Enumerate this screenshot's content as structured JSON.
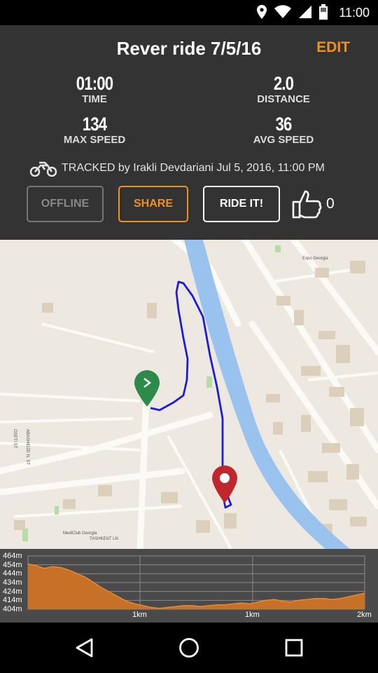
{
  "status_bar": {
    "time": "11:00"
  },
  "header": {
    "title": "Rever ride 7/5/16",
    "edit_label": "EDIT",
    "stats": {
      "time": {
        "value": "01:00",
        "label": "TIME"
      },
      "distance": {
        "value": "2.0",
        "label": "DISTANCE"
      },
      "max_speed": {
        "value": "134",
        "label": "MAX SPEED"
      },
      "avg_speed": {
        "value": "36",
        "label": "AVG SPEED"
      }
    },
    "tracked_text": "TRACKED by Irakli Devdariani Jul 5, 2016, 11:00 PM",
    "buttons": {
      "offline": "OFFLINE",
      "share": "SHARE",
      "ride_it": "RIDE IT!"
    },
    "like_count": "0"
  },
  "map": {
    "labels": {
      "expo": "Expo Georgia",
      "abashidze": "ABASHIDZE N. ST",
      "osetti": "OSETI ST",
      "tashkent": "TASHKENT LN",
      "mediclub": "MediClub Georgia"
    },
    "start_icon": "chevron-right-icon",
    "end_icon": "map-pin-icon",
    "route_color": "#1c1cd6",
    "river_color": "#99c3ee"
  },
  "elevation": {
    "y_labels": [
      "464m",
      "454m",
      "444m",
      "434m",
      "424m",
      "414m",
      "404m"
    ],
    "x_labels": [
      "1km",
      "1km",
      "2km"
    ],
    "fill_color": "#c77027",
    "profile_m": [
      455,
      453,
      450,
      452,
      451,
      448,
      444,
      440,
      434,
      428,
      423,
      418,
      413,
      410,
      408,
      406,
      405,
      406,
      407,
      408,
      408,
      407,
      408,
      409,
      409,
      410,
      411,
      410,
      412,
      414,
      415,
      413,
      412,
      414,
      415,
      416,
      416,
      415,
      416,
      418,
      420,
      422
    ]
  },
  "colors": {
    "accent": "#f2901c",
    "header_bg": "#333333"
  }
}
